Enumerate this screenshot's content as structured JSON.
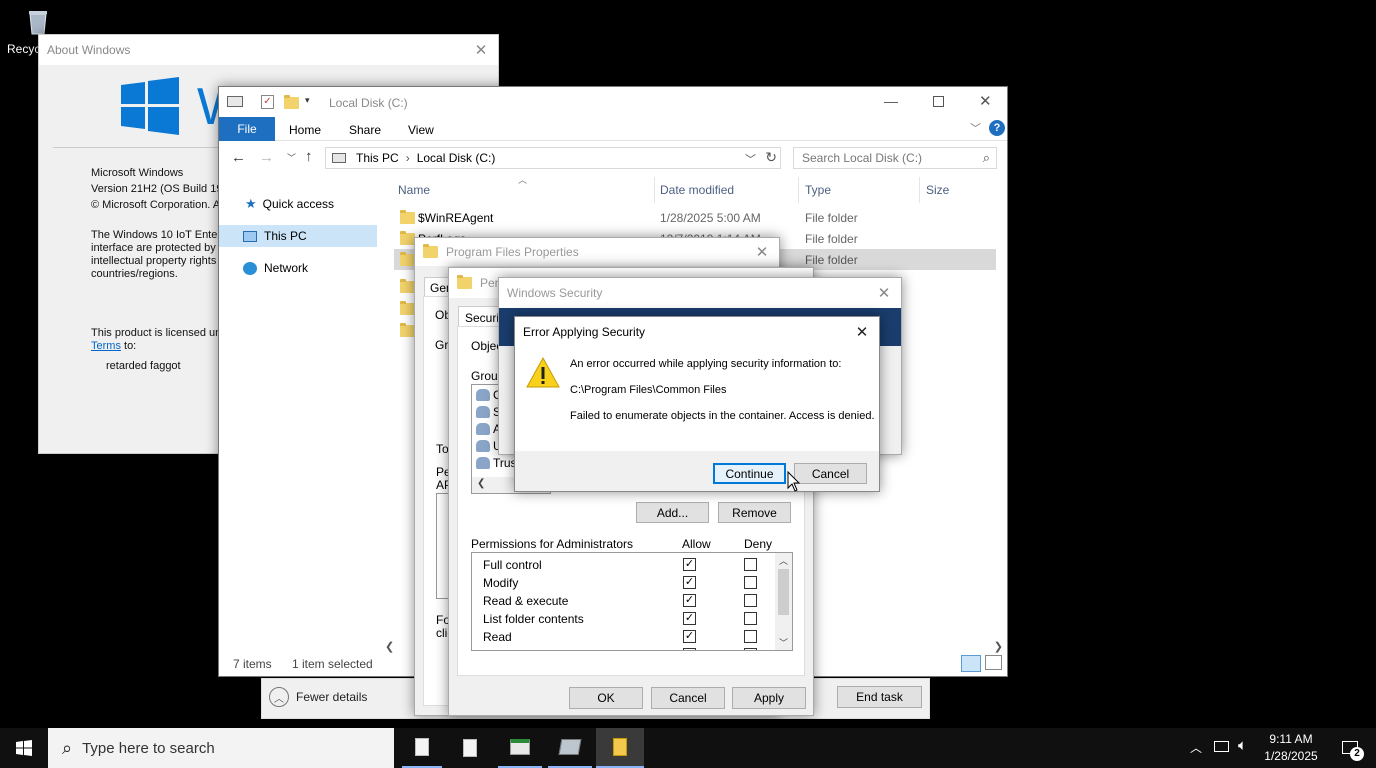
{
  "desktop": {
    "recycle_bin_label": "Recyc"
  },
  "about_windows": {
    "title": "About Windows",
    "logo_text": "W",
    "lines": [
      "Microsoft Windows",
      "Version 21H2 (OS Build 190",
      "© Microsoft Corporation. A"
    ],
    "legal": [
      "The Windows 10 IoT Enter",
      "interface are protected by",
      "intellectual property rights",
      "countries/regions."
    ],
    "license_text": "This product is licensed und",
    "terms_link": "Terms",
    "terms_suffix": " to:",
    "licensed_to": "retarded faggot"
  },
  "explorer": {
    "title": "Local Disk (C:)",
    "ribbon_tabs": [
      "File",
      "Home",
      "Share",
      "View"
    ],
    "breadcrumb": [
      "This PC",
      "Local Disk (C:)"
    ],
    "search_placeholder": "Search Local Disk (C:)",
    "nav": [
      "Quick access",
      "This PC",
      "Network"
    ],
    "columns": [
      "Name",
      "Date modified",
      "Type",
      "Size"
    ],
    "rows": [
      {
        "name": "$WinREAgent",
        "date": "1/28/2025 5:00 AM",
        "type": "File folder"
      },
      {
        "name": "PerfLogs",
        "date": "12/7/2019 1:14 AM",
        "type": "File folder"
      },
      {
        "name": "",
        "date": "",
        "type": "File folder"
      }
    ],
    "status_items": "7 items",
    "status_selected": "1 item selected"
  },
  "task_manager": {
    "fewer_details": "Fewer details",
    "end_task": "End task"
  },
  "props": {
    "title": "Program Files Properties",
    "tab_partial": "Gen",
    "labels": [
      "Obj",
      "Grou",
      "To",
      "Per",
      "AP",
      "For",
      "clic"
    ]
  },
  "permissions": {
    "title_partial": "Pern",
    "security_tab": "Security",
    "object_label": "Objec",
    "group_label": "Group",
    "group_items": [
      "C",
      "S",
      "A",
      "U",
      "Trus"
    ],
    "add_button": "Add...",
    "remove_button": "Remove",
    "perm_for": "Permissions for Administrators",
    "allow": "Allow",
    "deny": "Deny",
    "perms": [
      "Full control",
      "Modify",
      "Read & execute",
      "List folder contents",
      "Read"
    ],
    "ok": "OK",
    "cancel": "Cancel",
    "apply": "Apply"
  },
  "win_security": {
    "title": "Windows Security"
  },
  "error_dialog": {
    "title": "Error Applying Security",
    "line1": "An error occurred while applying security information to:",
    "path": "C:\\Program Files\\Common Files",
    "line2": "Failed to enumerate objects in the container. Access is denied.",
    "continue": "Continue",
    "cancel": "Cancel"
  },
  "taskbar": {
    "search_placeholder": "Type here to search",
    "time": "9:11 AM",
    "date": "1/28/2025",
    "notification_count": "2"
  }
}
